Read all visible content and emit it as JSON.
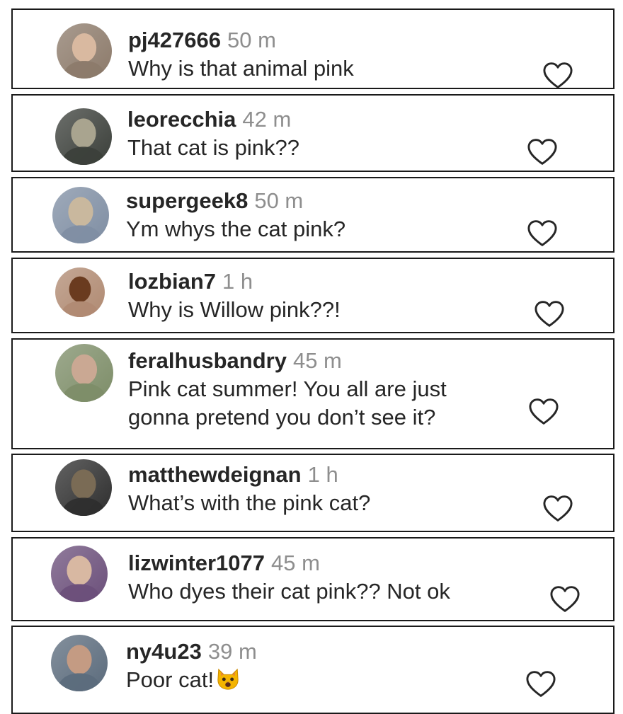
{
  "comments": [
    {
      "username": "pj427666",
      "time": "50 m",
      "lines": [
        "Why is that animal pink"
      ],
      "avatar_colors": [
        "#8c7a6a",
        "#d9b9a0"
      ]
    },
    {
      "username": "leorecchia",
      "time": "42 m",
      "lines": [
        "That cat is pink??"
      ],
      "avatar_colors": [
        "#3b3f3a",
        "#a9a48f"
      ]
    },
    {
      "username": "supergeek8",
      "time": "50 m",
      "lines": [
        "Ym whys the cat pink?"
      ],
      "avatar_colors": [
        "#7f8ea3",
        "#c9b89e"
      ]
    },
    {
      "username": "lozbian7",
      "time": "1 h",
      "lines": [
        "Why is Willow pink??!"
      ],
      "avatar_colors": [
        "#b08a72",
        "#6a3b1f"
      ]
    },
    {
      "username": "feralhusbandry",
      "time": "45 m",
      "lines": [
        "Pink cat summer! You all are just",
        "gonna pretend you don’t see it?"
      ],
      "avatar_colors": [
        "#7d8d68",
        "#caa893"
      ]
    },
    {
      "username": "matthewdeignan",
      "time": "1 h",
      "lines": [
        "What’s with the pink cat?"
      ],
      "avatar_colors": [
        "#2e2e2e",
        "#7a6b55"
      ]
    },
    {
      "username": "lizwinter1077",
      "time": "45 m",
      "lines": [
        "Who dyes their cat pink?? Not ok"
      ],
      "avatar_colors": [
        "#6b4f7a",
        "#d8b8a2"
      ]
    },
    {
      "username": "ny4u23",
      "time": "39 m",
      "lines": [
        "Poor cat!"
      ],
      "emoji": "cat-face-emoji",
      "avatar_colors": [
        "#5b6b7c",
        "#c49b83"
      ]
    }
  ],
  "like_icon": "heart-outline-icon"
}
